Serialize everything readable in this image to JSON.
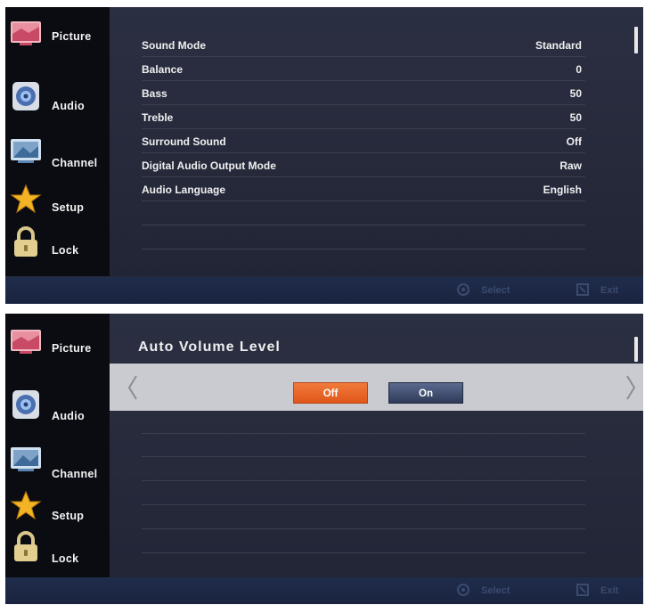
{
  "sidebar": {
    "items": [
      {
        "label": "Picture",
        "icon": "picture-icon"
      },
      {
        "label": "Audio",
        "icon": "audio-speaker-icon"
      },
      {
        "label": "Channel",
        "icon": "channel-tv-icon"
      },
      {
        "label": "Setup",
        "icon": "setup-star-icon"
      },
      {
        "label": "Lock",
        "icon": "lock-icon"
      }
    ]
  },
  "audio_menu": {
    "rows": [
      {
        "label": "Sound Mode",
        "value": "Standard"
      },
      {
        "label": "Balance",
        "value": "0"
      },
      {
        "label": "Bass",
        "value": "50"
      },
      {
        "label": "Treble",
        "value": "50"
      },
      {
        "label": "Surround Sound",
        "value": "Off"
      },
      {
        "label": "Digital Audio Output Mode",
        "value": "Raw"
      },
      {
        "label": "Audio Language",
        "value": "English"
      }
    ]
  },
  "auto_volume": {
    "title": "Auto Volume Level",
    "options": {
      "off": "Off",
      "on": "On"
    },
    "selected": "Off"
  },
  "footer": {
    "select_label": "Select",
    "exit_label": "Exit"
  },
  "colors": {
    "panel_bg": "#26293a",
    "sidebar_bg": "#0b0c12",
    "footer_bg": "#1f2c4b",
    "selected_option": "#e8622a",
    "unselected_option": "#3f4c6e",
    "highlight_band": "#c9cbd0"
  }
}
